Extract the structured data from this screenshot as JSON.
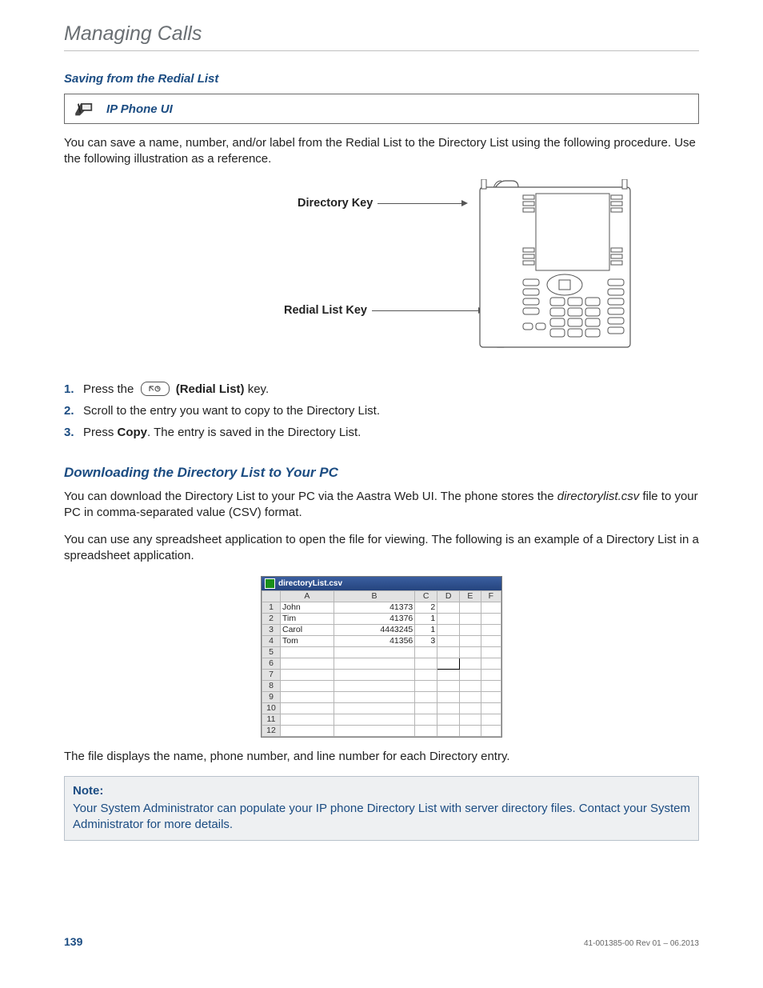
{
  "header": {
    "title": "Managing Calls"
  },
  "section1": {
    "heading": "Saving from the Redial List",
    "ip_box_label": "IP Phone UI",
    "intro": "You can save a name, number, and/or label from the Redial List to the Directory List using the following procedure. Use the following illustration as a reference."
  },
  "diagram": {
    "label_directory_key": "Directory Key",
    "label_redial_key": "Redial List Key"
  },
  "steps": [
    {
      "pre": "Press the ",
      "key": "(Redial List)",
      "post": " key."
    },
    {
      "full": "Scroll to the entry you want to copy to the Directory List."
    },
    {
      "pre": "Press ",
      "bold": "Copy",
      "post": ". The entry is saved in the Directory List."
    }
  ],
  "section2": {
    "heading": "Downloading the Directory List to Your PC",
    "p1a": "You can download the Directory List to your PC via the Aastra Web UI. The phone stores the ",
    "p1file": "directorylist.csv",
    "p1b": " file to your PC in comma-separated value (CSV) format.",
    "p2": "You can use any spreadsheet application to open the file for viewing. The following is an example of a Directory List in a spreadsheet application.",
    "p3": "The file displays the name, phone number, and line number for each Directory entry."
  },
  "spreadsheet": {
    "filename": "directoryList.csv",
    "cols": [
      "A",
      "B",
      "C",
      "D",
      "E",
      "F"
    ],
    "rows": [
      {
        "n": "1",
        "A": "John",
        "B": "41373",
        "C": "2"
      },
      {
        "n": "2",
        "A": "Tim",
        "B": "41376",
        "C": "1"
      },
      {
        "n": "3",
        "A": "Carol",
        "B": "4443245",
        "C": "1"
      },
      {
        "n": "4",
        "A": "Tom",
        "B": "41356",
        "C": "3"
      },
      {
        "n": "5"
      },
      {
        "n": "6"
      },
      {
        "n": "7"
      },
      {
        "n": "8"
      },
      {
        "n": "9"
      },
      {
        "n": "10"
      },
      {
        "n": "11"
      },
      {
        "n": "12"
      }
    ]
  },
  "note": {
    "head": "Note:",
    "body": "Your System Administrator can populate your IP phone Directory List with server directory files. Contact your System Administrator for more details."
  },
  "footer": {
    "page": "139",
    "rev": "41-001385-00 Rev 01 – 06.2013"
  }
}
